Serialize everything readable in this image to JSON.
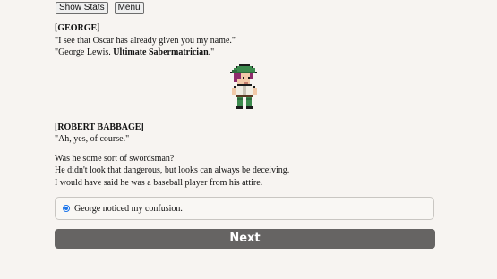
{
  "toolbar": {
    "show_stats_label": "Show Stats",
    "menu_label": "Menu"
  },
  "dialogue": {
    "george_speaker": "[GEORGE]",
    "george_line1": "\"I see that Oscar has already given you my name.\"",
    "george_line2_prefix": "\"George Lewis. ",
    "george_line2_bold": "Ultimate Sabermatrician",
    "george_line2_suffix": ".\"",
    "babbage_speaker": "[ROBERT BABBAGE]",
    "babbage_line1": "\"Ah, yes, of course.\"",
    "narration_line1": "Was he some sort of swordsman?",
    "narration_line2": "He didn't look that dangerous, but looks can always be deceiving.",
    "narration_line3": "I would have said  he was a baseball player from his attire."
  },
  "choice": {
    "label": "George noticed my confusion.",
    "selected": true
  },
  "next_label": "Next",
  "sprite": {
    "icon": "george-pixel-sprite",
    "cap_color": "#3d8a4e",
    "hair_color": "#8e2c6c",
    "skin_color": "#f2c9a8"
  }
}
